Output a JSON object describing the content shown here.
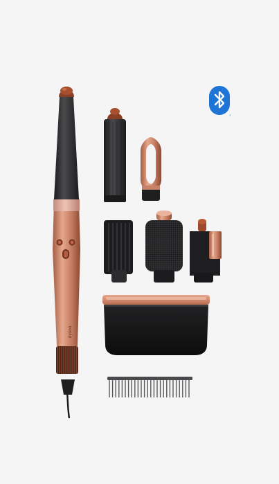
{
  "product": {
    "brand_mark": "dyson",
    "icons": {
      "bluetooth": "bluetooth-icon",
      "registered": "®"
    },
    "colors": {
      "background": "#f5f5f5",
      "copper": "#c27a5f",
      "copper_dark": "#8a4a33",
      "graphite": "#2b2b2d",
      "blush": "#d9a79a",
      "bluetooth_blue": "#1f75d6"
    }
  }
}
